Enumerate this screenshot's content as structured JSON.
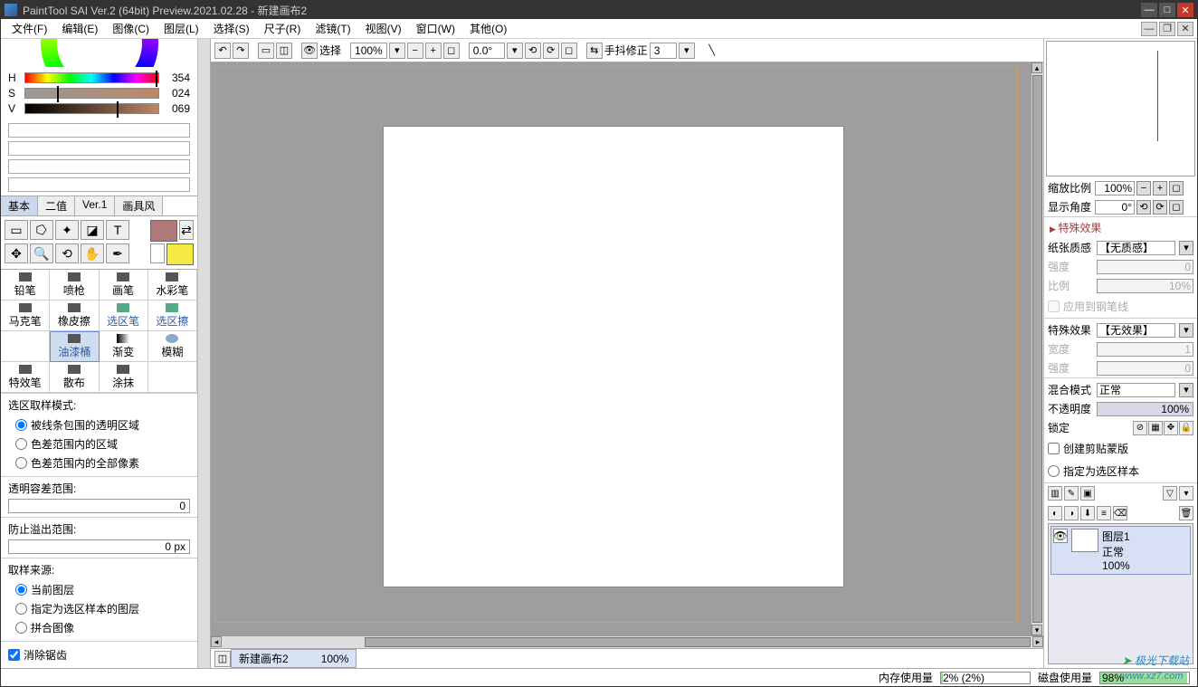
{
  "title": "PaintTool SAI Ver.2 (64bit) Preview.2021.02.28 - 新建画布2",
  "menus": [
    "文件(F)",
    "编辑(E)",
    "图像(C)",
    "图层(L)",
    "选择(S)",
    "尺子(R)",
    "滤镜(T)",
    "视图(V)",
    "窗口(W)",
    "其他(O)"
  ],
  "hsv": {
    "h_label": "H",
    "s_label": "S",
    "v_label": "V",
    "h": "354",
    "s": "024",
    "v": "069"
  },
  "tabs": {
    "basic": "基本",
    "binary": "二值",
    "ver1": "Ver.1",
    "brush": "画具风"
  },
  "brushes": {
    "r1": [
      "铅笔",
      "喷枪",
      "画笔",
      "水彩笔"
    ],
    "r2": [
      "马克笔",
      "橡皮擦",
      "选区笔",
      "选区擦"
    ],
    "r3": [
      "",
      "油漆桶",
      "渐变",
      "模糊"
    ],
    "r4": [
      "特效笔",
      "散布",
      "涂抹",
      ""
    ]
  },
  "selmode": {
    "title": "选区取样模式:",
    "opt1": "被线条包围的透明区域",
    "opt2": "色差范围内的区域",
    "opt3": "色差范围内的全部像素"
  },
  "tol": {
    "title": "透明容差范围:",
    "val": "0"
  },
  "overflow": {
    "title": "防止溢出范围:",
    "val": "0 px"
  },
  "source": {
    "title": "取样来源:",
    "opt1": "当前图层",
    "opt2": "指定为选区样本的图层",
    "opt3": "拼合图像"
  },
  "antialias": "消除锯齿",
  "toolbar": {
    "select": "选择",
    "zoom": "100%",
    "angle": "0.0°",
    "stab_label": "手抖修正",
    "stab": "3"
  },
  "doc": {
    "name": "新建画布2",
    "zoom": "100%"
  },
  "right": {
    "zoom_label": "缩放比例",
    "zoom": "100%",
    "angle_label": "显示角度",
    "angle": "0°",
    "fx_header": "特殊效果",
    "paper_label": "纸张质感",
    "paper_val": "【无质感】",
    "strength_label": "强度",
    "strength_val": "0",
    "ratio_label": "比例",
    "ratio_val": "10%",
    "applypen": "应用到钢笔线",
    "fx_label": "特殊效果",
    "fx_val": "【无效果】",
    "width_label": "宽度",
    "width_val": "1",
    "str2_label": "强度",
    "str2_val": "0",
    "blend_label": "混合模式",
    "blend_val": "正常",
    "opacity_label": "不透明度",
    "opacity_val": "100%",
    "lock_label": "锁定",
    "clip": "创建剪贴蒙版",
    "selsample": "指定为选区样本",
    "layer_name": "图层1",
    "layer_mode": "正常",
    "layer_op": "100%"
  },
  "status": {
    "mem_label": "内存使用量",
    "mem_txt": "2% (2%)",
    "mem_pct": 2,
    "disk_label": "磁盘使用量",
    "disk_txt": "98%",
    "disk_pct": 98
  },
  "watermark": {
    "brand": "极光下载站",
    "url": "www.xz7.com"
  }
}
